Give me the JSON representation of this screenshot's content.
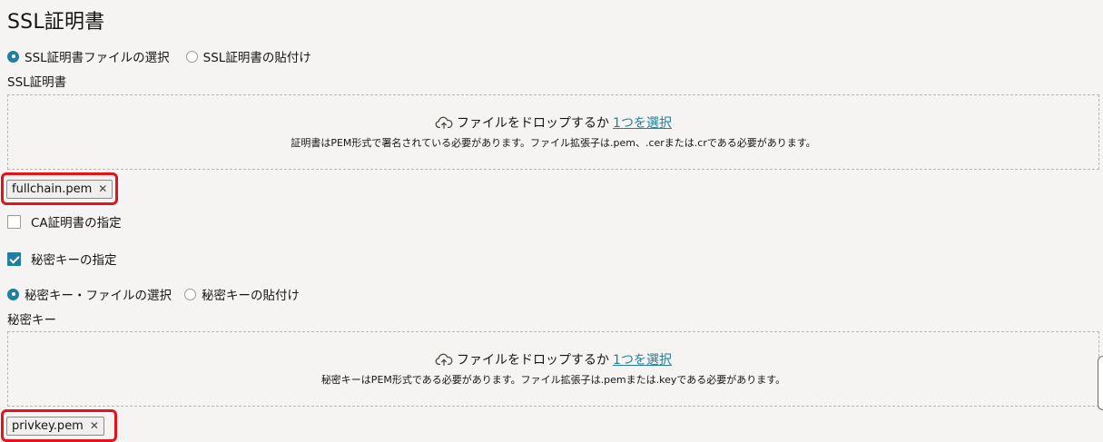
{
  "page": {
    "title": "SSL証明書"
  },
  "ssl": {
    "radio_file": "SSL証明書ファイルの選択",
    "radio_paste": "SSL証明書の貼付け",
    "field_label": "SSL証明書",
    "dropzone": {
      "prompt": "ファイルをドロップするか",
      "link": "1つを選択",
      "hint": "証明書はPEM形式で署名されている必要があります。ファイル拡張子は.pem、.cerまたは.crである必要があります。"
    },
    "file_chip": "fullchain.pem"
  },
  "ca_cert": {
    "label": "CA証明書の指定",
    "checked": false
  },
  "private_key_toggle": {
    "label": "秘密キーの指定",
    "checked": true
  },
  "private_key": {
    "radio_file": "秘密キー・ファイルの選択",
    "radio_paste": "秘密キーの貼付け",
    "field_label": "秘密キー",
    "dropzone": {
      "prompt": "ファイルをドロップするか",
      "link": "1つを選択",
      "hint": "秘密キーはPEM形式である必要があります。ファイル拡張子は.pemまたは.keyである必要があります。"
    },
    "file_chip": "privkey.pem"
  },
  "colors": {
    "accent": "#227e9e",
    "highlight": "#e5121c",
    "background": "#f5f4f2"
  }
}
